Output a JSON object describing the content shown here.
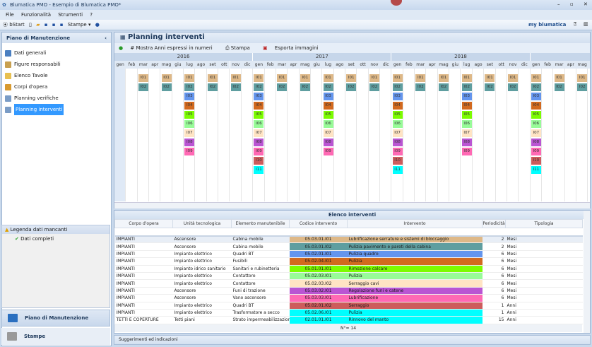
{
  "window": {
    "title": "Blumatica PMO - Esempio di Blumatica PMO*"
  },
  "menu": [
    "File",
    "Funzionalità",
    "Strumenti",
    "?"
  ],
  "toolbar": {
    "start": "bStart",
    "stampe": "Stampe ▾",
    "brand": "my blumatica"
  },
  "sidebar": {
    "title": "Piano di Manutenzione",
    "collapse": "‹",
    "items": [
      {
        "label": "Dati generali",
        "color": "#4a7fc1"
      },
      {
        "label": "Figure responsabili",
        "color": "#c8a050"
      },
      {
        "label": "Elenco Tavole",
        "color": "#e8c050"
      },
      {
        "label": "Corpi d'opera",
        "color": "#d89a30"
      },
      {
        "label": "Planning verifiche",
        "color": "#7a9cc6"
      },
      {
        "label": "Planning interventi",
        "color": "#7a9cc6",
        "selected": true
      }
    ]
  },
  "legend": {
    "title": "Legenda dati mancanti",
    "item": "Dati completi"
  },
  "bottom_nav": [
    {
      "label": "Piano di Manutenzione"
    },
    {
      "label": "Stampe"
    }
  ],
  "planning": {
    "title": "Planning interventi",
    "tools": [
      "Mostra Anni espressi in numeri",
      "Stampa",
      "Esporta immagini"
    ],
    "years": [
      "2016",
      "2017",
      "2018",
      "2019"
    ],
    "months": [
      "gen",
      "feb",
      "mar",
      "apr",
      "mag",
      "giu",
      "lug",
      "ago",
      "set",
      "ott",
      "nov",
      "dic"
    ],
    "interventions": [
      {
        "code": "I01",
        "color": "#deb887",
        "first": "2016-03",
        "period_months": 2
      },
      {
        "code": "I02",
        "color": "#5f9ea0",
        "first": "2016-03",
        "period_months": 2
      },
      {
        "code": "I03",
        "color": "#6495ed",
        "first": "2016-07",
        "period_months": 6
      },
      {
        "code": "I04",
        "color": "#d2691e",
        "first": "2016-07",
        "period_months": 6
      },
      {
        "code": "I05",
        "color": "#7cfc00",
        "first": "2016-07",
        "period_months": 6
      },
      {
        "code": "I06",
        "color": "#98fb98",
        "first": "2016-07",
        "period_months": 6
      },
      {
        "code": "I07",
        "color": "#ffe4c4",
        "first": "2016-07",
        "period_months": 6
      },
      {
        "code": "I08",
        "color": "#ba55d3",
        "first": "2016-07",
        "period_months": 6
      },
      {
        "code": "I09",
        "color": "#ff69b4",
        "first": "2016-07",
        "period_months": 6
      },
      {
        "code": "I10",
        "color": "#cd5c5c",
        "first": "2017-01",
        "period_months": 12
      },
      {
        "code": "I11",
        "color": "#00ffff",
        "first": "2017-01",
        "period_months": 12
      }
    ]
  },
  "table": {
    "title": "Elenco interventi",
    "columns": [
      "Corpo d'opera",
      "Unità tecnologica",
      "Elemento manutenibile",
      "Codice intervento",
      "Intervento",
      "Periodicità",
      "Tipologia"
    ],
    "rows": [
      [
        "IMPIANTI",
        "Ascensore",
        "Cabina mobile",
        "05.03.01.I01",
        "Lubrificazione serrature e sistemi di bloccaggio",
        "2",
        "Mesi",
        "#deb887"
      ],
      [
        "IMPIANTI",
        "Ascensore",
        "Cabina mobile",
        "05.03.01.I02",
        "Pulizia pavimento e pareti della cabina",
        "2",
        "Mesi",
        "#5f9ea0"
      ],
      [
        "IMPIANTI",
        "Impianto elettrico",
        "Quadri BT",
        "05.02.01.I01",
        "Pulizia quadro",
        "6",
        "Mesi",
        "#6495ed"
      ],
      [
        "IMPIANTI",
        "Impianto elettrico",
        "Fusibili",
        "05.02.04.I01",
        "Pulizia",
        "6",
        "Mesi",
        "#d2691e"
      ],
      [
        "IMPIANTI",
        "Impianto idrico sanitario",
        "Sanitari e rubinetteria",
        "05.01.01.I01",
        "Rimozione calcare",
        "6",
        "Mesi",
        "#7cfc00"
      ],
      [
        "IMPIANTI",
        "Impianto elettrico",
        "Contattore",
        "05.02.03.I01",
        "Pulizia",
        "6",
        "Mesi",
        "#98fb98"
      ],
      [
        "IMPIANTI",
        "Impianto elettrico",
        "Contattore",
        "05.02.03.I02",
        "Serraggio cavi",
        "6",
        "Mesi",
        "#ffe4c4"
      ],
      [
        "IMPIANTI",
        "Ascensore",
        "Funi di trazione",
        "05.03.02.I01",
        "Regolazione funi e catene",
        "6",
        "Mesi",
        "#ba55d3"
      ],
      [
        "IMPIANTI",
        "Ascensore",
        "Vano ascensore",
        "05.03.03.I01",
        "Lubrificazione",
        "6",
        "Mesi",
        "#ff69b4"
      ],
      [
        "IMPIANTI",
        "Impianto elettrico",
        "Quadri BT",
        "05.02.01.I02",
        "Serraggio",
        "1",
        "Anni",
        "#cd5c5c"
      ],
      [
        "IMPIANTI",
        "Impianto elettrico",
        "Trasformatore a secco",
        "05.02.06.I01",
        "Pulizia",
        "1",
        "Anni",
        "#00ffff"
      ],
      [
        "TETTI E COPERTURE",
        "Tetti piani",
        "Strato impermeabilizzazione...",
        "02.01.01.I01",
        "Rinnovo del manto",
        "15",
        "Anni",
        "#00ffff"
      ]
    ],
    "footer": "N°= 14"
  },
  "status": "Suggerimenti ed indicazioni"
}
